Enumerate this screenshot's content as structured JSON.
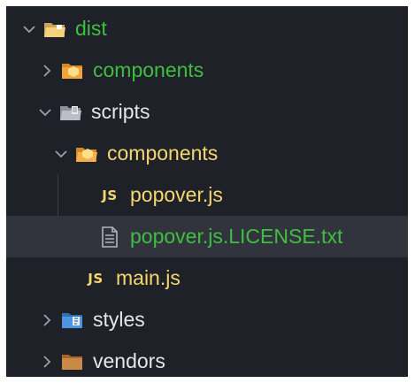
{
  "colors": {
    "background": "#1f2129",
    "selected_row": "#32343d",
    "text_green": "#3fbf3f",
    "text_yellow": "#f5d76e",
    "text_white": "#e6e6e6",
    "chevron": "#9aa0aa"
  },
  "tree": [
    {
      "label": "dist",
      "icon": "folder-open-icon",
      "expanded": true,
      "color": "green"
    },
    {
      "label": "components",
      "icon": "folder-components-icon",
      "expanded": false,
      "color": "green"
    },
    {
      "label": "scripts",
      "icon": "folder-scripts-icon",
      "expanded": true,
      "color": "white"
    },
    {
      "label": "components",
      "icon": "folder-components-open-icon",
      "expanded": true,
      "color": "yellow"
    },
    {
      "label": "popover.js",
      "icon": "js-file-icon",
      "icon_text": "JS",
      "color": "yellow"
    },
    {
      "label": "popover.js.LICENSE.txt",
      "icon": "text-file-icon",
      "color": "green",
      "selected": true
    },
    {
      "label": "main.js",
      "icon": "js-file-icon",
      "icon_text": "JS",
      "color": "yellow"
    },
    {
      "label": "styles",
      "icon": "folder-styles-icon",
      "expanded": false,
      "color": "white"
    },
    {
      "label": "vendors",
      "icon": "folder-vendors-icon",
      "expanded": false,
      "color": "white"
    }
  ]
}
